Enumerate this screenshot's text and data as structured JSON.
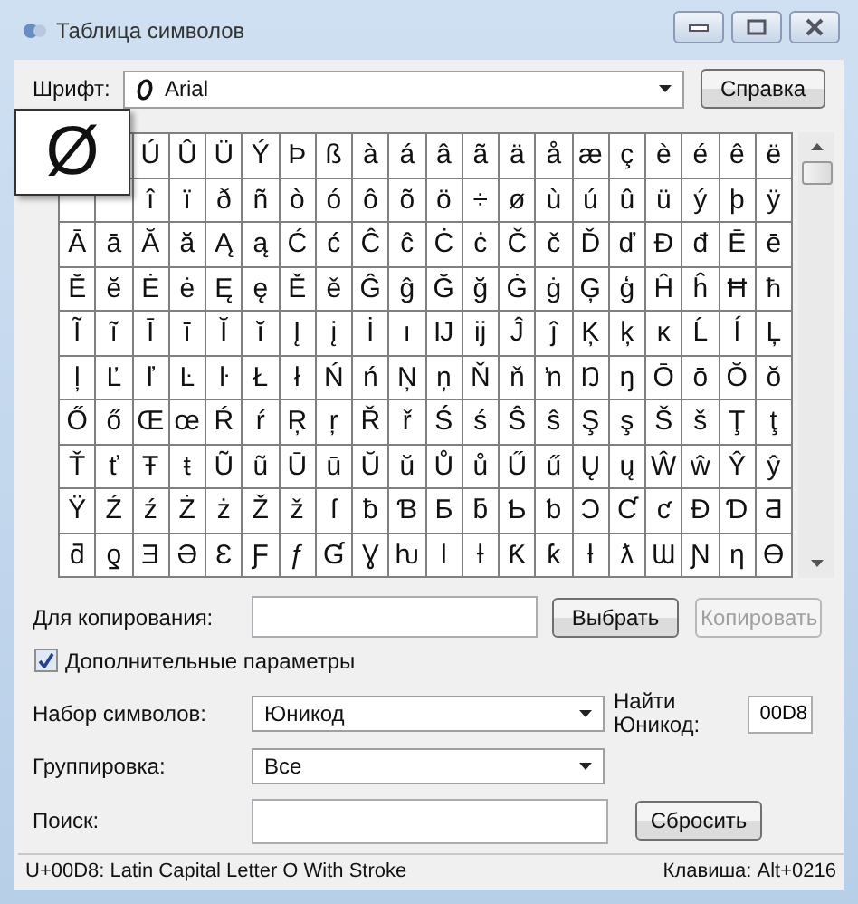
{
  "window": {
    "title": "Таблица символов"
  },
  "font": {
    "label": "Шрифт:",
    "value": "Arial"
  },
  "help_button": "Справка",
  "grid": {
    "rows": [
      [
        null,
        "",
        "Ú",
        "Û",
        "Ü",
        "Ý",
        "Þ",
        "ß",
        "à",
        "á",
        "â",
        "ã",
        "ä",
        "å",
        "æ",
        "ç",
        "è",
        "é",
        "ê",
        "ë"
      ],
      [
        "",
        "",
        "î",
        "ï",
        "ð",
        "ñ",
        "ò",
        "ó",
        "ô",
        "õ",
        "ö",
        "÷",
        "ø",
        "ù",
        "ú",
        "û",
        "ü",
        "ý",
        "þ",
        "ÿ"
      ],
      [
        "Ā",
        "ā",
        "Ă",
        "ă",
        "Ą",
        "ą",
        "Ć",
        "ć",
        "Ĉ",
        "ĉ",
        "Ċ",
        "ċ",
        "Č",
        "č",
        "Ď",
        "ď",
        "Đ",
        "đ",
        "Ē",
        "ē"
      ],
      [
        "Ĕ",
        "ĕ",
        "Ė",
        "ė",
        "Ę",
        "ę",
        "Ě",
        "ě",
        "Ĝ",
        "ĝ",
        "Ğ",
        "ğ",
        "Ġ",
        "ġ",
        "Ģ",
        "ģ",
        "Ĥ",
        "ĥ",
        "Ħ",
        "ħ"
      ],
      [
        "Ĩ",
        "ĩ",
        "Ī",
        "ī",
        "Ĭ",
        "ĭ",
        "Į",
        "į",
        "İ",
        "ı",
        "Ĳ",
        "ĳ",
        "Ĵ",
        "ĵ",
        "Ķ",
        "ķ",
        "ĸ",
        "Ĺ",
        "ĺ",
        "Ļ"
      ],
      [
        "ļ",
        "Ľ",
        "ľ",
        "Ŀ",
        "ŀ",
        "Ł",
        "ł",
        "Ń",
        "ń",
        "Ņ",
        "ņ",
        "Ň",
        "ň",
        "ŉ",
        "Ŋ",
        "ŋ",
        "Ō",
        "ō",
        "Ŏ",
        "ŏ"
      ],
      [
        "Ő",
        "ő",
        "Œ",
        "œ",
        "Ŕ",
        "ŕ",
        "Ŗ",
        "ŗ",
        "Ř",
        "ř",
        "Ś",
        "ś",
        "Ŝ",
        "ŝ",
        "Ş",
        "ş",
        "Š",
        "š",
        "Ţ",
        "ţ"
      ],
      [
        "Ť",
        "ť",
        "Ŧ",
        "ŧ",
        "Ũ",
        "ũ",
        "Ū",
        "ū",
        "Ŭ",
        "ŭ",
        "Ů",
        "ů",
        "Ű",
        "ű",
        "Ų",
        "ų",
        "Ŵ",
        "ŵ",
        "Ŷ",
        "ŷ"
      ],
      [
        "Ÿ",
        "Ź",
        "ź",
        "Ż",
        "ż",
        "Ž",
        "ž",
        "ſ",
        "ƀ",
        "Ɓ",
        "Ƃ",
        "ƃ",
        "Ƅ",
        "ƅ",
        "Ɔ",
        "Ƈ",
        "ƈ",
        "Ɖ",
        "Ɗ",
        "Ƌ"
      ],
      [
        "ƌ",
        "ƍ",
        "Ǝ",
        "Ə",
        "Ɛ",
        "Ƒ",
        "ƒ",
        "Ɠ",
        "Ɣ",
        "ƕ",
        "Ɩ",
        "Ɨ",
        "Ƙ",
        "ƙ",
        "ƚ",
        "ƛ",
        "Ɯ",
        "Ɲ",
        "ƞ",
        "Ɵ"
      ]
    ]
  },
  "preview": {
    "char": "Ø"
  },
  "copy": {
    "label": "Для копирования:",
    "select_button": "Выбрать",
    "copy_button": {
      "label": "Копировать",
      "disabled": true
    }
  },
  "advanced": {
    "label": "Дополнительные параметры",
    "checked": true
  },
  "charset": {
    "label": "Набор символов:",
    "value": "Юникод"
  },
  "find_unicode": {
    "label": "Найти Юникод:",
    "value": "00D8"
  },
  "grouping": {
    "label": "Группировка:",
    "value": "Все"
  },
  "search": {
    "label": "Поиск:",
    "reset_button": "Сбросить"
  },
  "status_bar": {
    "description": "U+00D8: Latin Capital Letter O With Stroke",
    "keystroke": "Клавиша: Alt+0216"
  }
}
